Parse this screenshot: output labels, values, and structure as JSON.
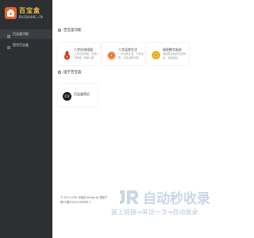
{
  "sidebar": {
    "logo_title": "百宝盒",
    "logo_sub": "BAIBAOHE.CN",
    "items": [
      {
        "label": "百宝盒功能"
      },
      {
        "label": "国学百宝盒"
      }
    ]
  },
  "sections": [
    {
      "title": "百宝盒功能",
      "cards": [
        {
          "title": "八字在线排盘",
          "desc": "八字在线排盘，在线八字看盘，紫微斗数",
          "icon": "red-gourd-icon"
        },
        {
          "title": "八字运势生活",
          "desc": "八字运势生活，今年运势，生肖运势日程",
          "icon": "orange-fortune-icon"
        },
        {
          "title": "易经数字起卦",
          "desc": "易经数字起卦在线测卦，在线起卦",
          "icon": "gold-coin-icon"
        }
      ]
    },
    {
      "title": "国学百宝盒",
      "cards": [
        {
          "title": "百宝盒简历",
          "desc": "",
          "icon": "dark-circle-logo-icon"
        }
      ]
    }
  ],
  "footer": {
    "line1": "© 2017-2024 百宝盒 design by 樵柴子",
    "line2": "豫ICP备2025123456号-1"
  },
  "watermark": {
    "title": "自动秒收录",
    "subtitle": "骏上链接→来访一次→自动收录"
  },
  "colors": {
    "sidebar_bg": "#2d2f33",
    "accent": "#e8642c",
    "logo_text": "#f5c242"
  }
}
